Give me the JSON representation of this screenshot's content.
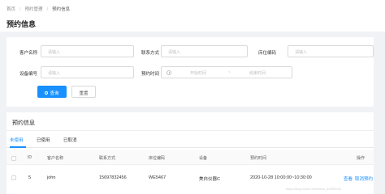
{
  "breadcrumb": {
    "home": "首页",
    "level2": "预约管理",
    "current": "预约信息",
    "separator": "/"
  },
  "page_title": "预约信息",
  "search_form": {
    "customer_name_label": "客户名称",
    "customer_name_placeholder": "请输入",
    "contact_label": "联系方式",
    "contact_placeholder": "请输入",
    "bed_code_label": "床位编码",
    "bed_code_placeholder": "请输入",
    "device_code_label": "设备编号",
    "device_code_placeholder": "请输入",
    "time_label": "预约时间",
    "start_placeholder": "开始时间",
    "range_sep": "~",
    "end_placeholder": "结束时间",
    "query_button": "查询",
    "reset_button": "重置"
  },
  "list": {
    "title": "预约信息",
    "tabs": [
      {
        "label": "未使用",
        "active": true
      },
      {
        "label": "已使用",
        "active": false
      },
      {
        "label": "已取消",
        "active": false
      }
    ],
    "columns": [
      "ID",
      "客户名称",
      "联系方式",
      "床位编码",
      "设备",
      "预约时间",
      "操作"
    ],
    "rows": [
      {
        "id": "5",
        "customer": "john",
        "contact": "15697832456",
        "bed_code": "WE5467",
        "device": "美白仪器C",
        "time": "2020-10-28 10:00:00~10:30:00",
        "action_view": "查看",
        "action_cancel": "取消预约"
      }
    ]
  },
  "watermark": "https://blog.csdn.net/weixin_46000000",
  "colors": {
    "primary": "#1890ff",
    "background": "#f0f2f5"
  }
}
